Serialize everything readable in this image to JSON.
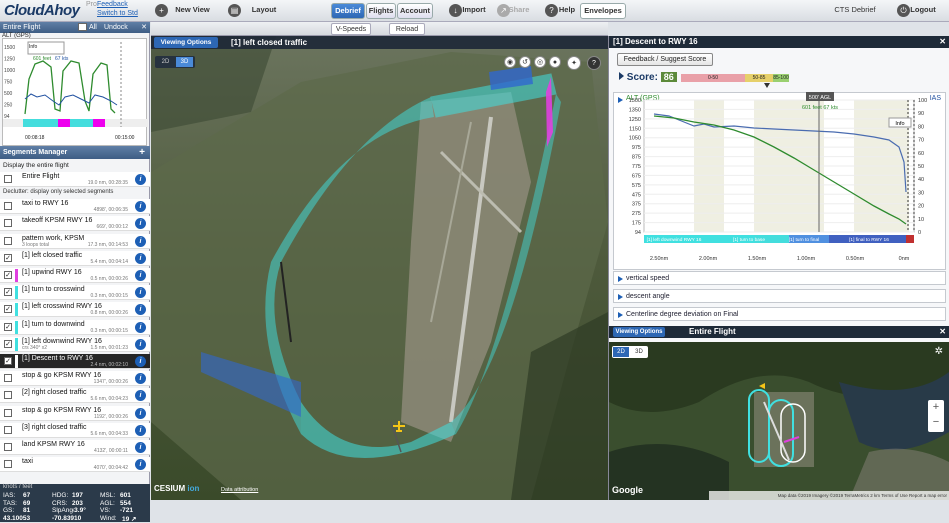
{
  "app": {
    "name": "CloudAhoy",
    "pro": "Pro",
    "feedback": "Feedback",
    "switch": "Switch to Std"
  },
  "nav": {
    "new_view": "New View",
    "layout": "Layout",
    "vspeeds": "V-Speeds",
    "reload": "Reload",
    "tabs": [
      "Debrief",
      "Flights",
      "Account"
    ],
    "import": "Import",
    "share": "Share",
    "help": "Help",
    "envelopes": "Envelopes",
    "user": "CTS Debrief",
    "logout": "Logout"
  },
  "left": {
    "entire_flight": "Entire Flight",
    "all": "All",
    "undock": "Undock",
    "mini_chart": {
      "label": "ALT (GPS)",
      "readout_feet": "601 feet",
      "readout_kts": "67 kts",
      "info": "Info",
      "yticks": [
        "1500",
        "1250",
        "1000",
        "750",
        "500",
        "250",
        "94"
      ],
      "t_start": "00:08:18",
      "t_end": "00:15:00"
    },
    "segments_manager": "Segments Manager",
    "display_entire": "Display the entire flight",
    "declutter": "Declutter: display only selected segments",
    "segments": [
      {
        "name": "Entire Flight",
        "stats": "19.0 nm, 00:28:35",
        "checked": false,
        "color": "#ffffff"
      },
      {
        "name": "taxi to RWY 16",
        "stats": "4898', 00:06:35",
        "checked": false,
        "color": "#ffffff"
      },
      {
        "name": "takeoff KPSM RWY 16",
        "stats": "669', 00:00:12",
        "checked": false,
        "color": "#ffffff"
      },
      {
        "name": "pattern work, KPSM",
        "stats": "17.3 nm, 00:14:53",
        "sub": "3 loops total",
        "checked": false,
        "color": "#ffffff"
      },
      {
        "name": "[1] left closed traffic",
        "stats": "5.4 nm, 00:04:14",
        "checked": true,
        "color": "#ffffff"
      },
      {
        "name": "[1] upwind RWY 16",
        "stats": "0.5 nm, 00:00:26",
        "checked": true,
        "color": "#e040e0"
      },
      {
        "name": "[1] turn to crosswind",
        "stats": "0.3 nm, 00:00:15",
        "checked": true,
        "color": "#40e0e0"
      },
      {
        "name": "[1] left crosswind RWY 16",
        "stats": "0.8 nm, 00:00:26",
        "checked": true,
        "color": "#40e0e0"
      },
      {
        "name": "[1] turn to downwind",
        "stats": "0.3 nm, 00:00:15",
        "checked": true,
        "color": "#40e0e0"
      },
      {
        "name": "[1] left downwind RWY 16",
        "stats": "1.5 nm, 00:01:23",
        "sub": "crs 340° x2",
        "checked": true,
        "color": "#40e0e0"
      },
      {
        "name": "[1] Descent to RWY 16",
        "stats": "2.4 nm, 00:02:10",
        "checked": true,
        "color": "#ffffff",
        "selected": true
      },
      {
        "name": "stop & go KPSM RWY 16",
        "stats": "1347', 00:00:26",
        "checked": false,
        "color": "#ffffff"
      },
      {
        "name": "[2] right closed traffic",
        "stats": "5.6 nm, 00:04:23",
        "checked": false,
        "color": "#ffffff"
      },
      {
        "name": "stop & go KPSM RWY 16",
        "stats": "1192', 00:00:26",
        "checked": false,
        "color": "#ffffff"
      },
      {
        "name": "[3] right closed traffic",
        "stats": "5.6 nm, 00:04:33",
        "checked": false,
        "color": "#ffffff"
      },
      {
        "name": "land KPSM RWY 16",
        "stats": "4132', 00:00:11",
        "checked": false,
        "color": "#ffffff"
      },
      {
        "name": "taxi",
        "stats": "4070', 00:04:42",
        "checked": false,
        "color": "#ffffff"
      }
    ],
    "units": "knots / feet",
    "stats": [
      [
        {
          "k": "IAS:",
          "v": "67"
        },
        {
          "k": "HDG:",
          "v": "197"
        },
        {
          "k": "MSL:",
          "v": "601"
        }
      ],
      [
        {
          "k": "TAS:",
          "v": "69"
        },
        {
          "k": "CRS:",
          "v": "203"
        },
        {
          "k": "AGL:",
          "v": "554"
        }
      ],
      [
        {
          "k": "GS:",
          "v": "81"
        },
        {
          "k": "SlpAng:",
          "v": "-3.9°"
        },
        {
          "k": "VS:",
          "v": "-721"
        }
      ],
      [
        {
          "k": "",
          "v": "43.10053"
        },
        {
          "k": "",
          "v": "-70.83910"
        },
        {
          "k": "Wind:",
          "v": "19 ↗"
        }
      ]
    ]
  },
  "center": {
    "viewing_options": "Viewing Options",
    "title": "[1] left closed traffic",
    "view2d": "2D",
    "view3d": "3D",
    "cesium": "CESIUM",
    "cesium_ion": "ion",
    "attribution": "Data attribution"
  },
  "right": {
    "title": "[1] Descent to RWY 16",
    "feedback": "Feedback / Suggest Score",
    "score_label": "Score:",
    "score": "86",
    "score_bands": [
      "0-50",
      "50-85",
      "85-100"
    ],
    "chart": {
      "series_label": "ALT (GPS)",
      "series2": "IAS",
      "agl_marker": "500' AGL",
      "readout": "601 feet  67 kts",
      "info": "Info",
      "yticks_left": [
        "1500",
        "1350",
        "1250",
        "1150",
        "1050",
        "975",
        "875",
        "775",
        "675",
        "575",
        "475",
        "375",
        "275",
        "175",
        "94"
      ],
      "yticks_right": [
        "100",
        "90",
        "80",
        "70",
        "60",
        "50",
        "40",
        "30",
        "20",
        "10",
        "0"
      ],
      "xticks": [
        "2.50nm",
        "2.00nm",
        "1.50nm",
        "1.00nm",
        "0.50nm",
        "0nm"
      ],
      "segments": [
        "[1] left downwind RWY 16",
        "[1] turn to base",
        "[1] turn to final",
        "[1] final to RWY 16"
      ]
    },
    "accordions": [
      "vertical speed",
      "descent angle",
      "Centerline degree deviation on Final"
    ],
    "overview": {
      "viewing_options": "Viewing Options",
      "title": "Entire Flight",
      "view2d": "2D",
      "view3d": "3D",
      "google": "Google",
      "footer": "Map data ©2019 Imagery ©2019 TerraMetrics   2 km   Terms of Use   Report a map error"
    }
  },
  "colors": {
    "accent": "#2d67b4",
    "alt": "#2e8b2e",
    "ias": "#2050a0",
    "pattern": "#40e0e0"
  }
}
